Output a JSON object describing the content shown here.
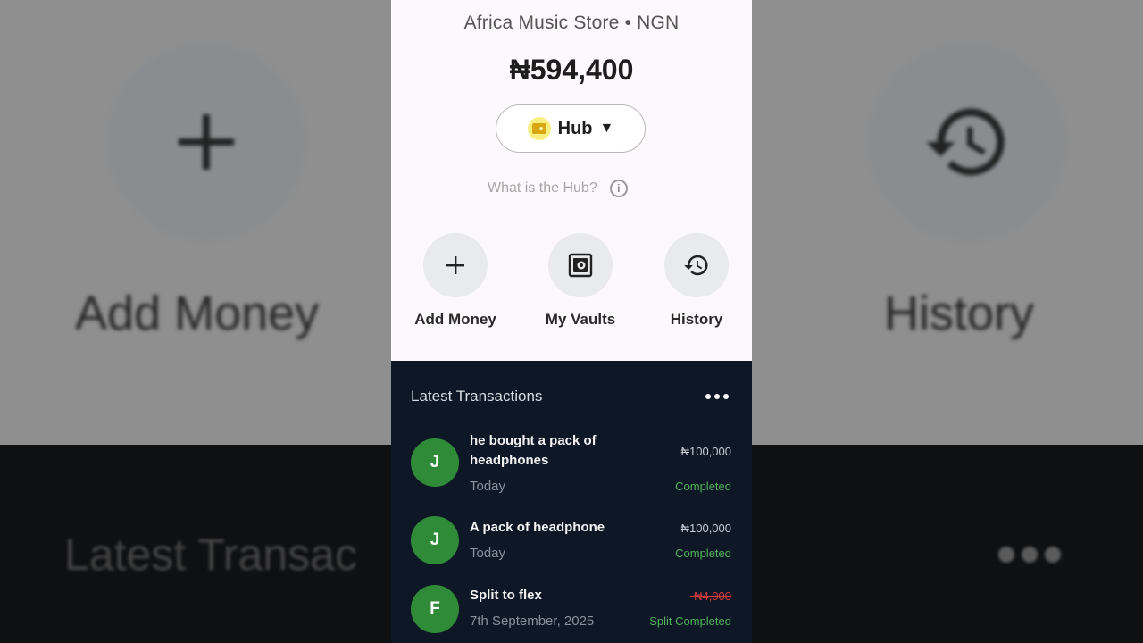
{
  "background": {
    "left_label": "Add Money",
    "right_label": "History",
    "latest_label": "Latest Transac"
  },
  "header": {
    "store_title": "Africa Music Store • NGN",
    "balance": "₦594,400"
  },
  "hub": {
    "label": "Hub",
    "caret": "▼",
    "what_is": "What is the Hub?"
  },
  "actions": [
    {
      "label": "Add Money",
      "icon": "plus-icon"
    },
    {
      "label": "My Vaults",
      "icon": "vault-icon"
    },
    {
      "label": "History",
      "icon": "history-icon"
    }
  ],
  "transactions": {
    "title": "Latest Transactions",
    "items": [
      {
        "initial": "J",
        "title": "he bought a pack of headphones",
        "date": "Today",
        "amount": "₦100,000",
        "status": "Completed"
      },
      {
        "initial": "J",
        "title": "A pack of headphone",
        "date": "Today",
        "amount": "₦100,000",
        "status": "Completed"
      },
      {
        "initial": "F",
        "title": "Split to flex",
        "date": "7th September, 2025",
        "amount": "-₦4,000",
        "status": "Split Completed"
      }
    ]
  },
  "colors": {
    "accent_green": "#2f8b38",
    "status_green": "#52b35a",
    "negative_red": "#d93a3a",
    "dark_panel": "#0e1726"
  }
}
